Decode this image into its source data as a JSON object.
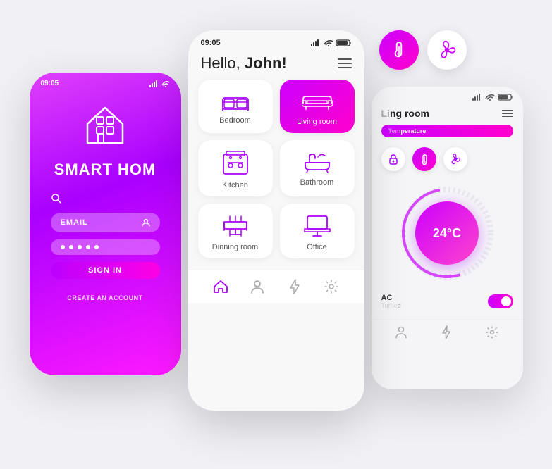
{
  "app": {
    "title": "Smart Home"
  },
  "left_phone": {
    "status_time": "09:05",
    "title": "SMART HOM",
    "email_placeholder": "EMAIL",
    "password_dots": 5,
    "sign_in_label": "SIGN IN",
    "create_account_label": "CREATE AN ACCOUNT"
  },
  "center_phone": {
    "status_time": "09:05",
    "greeting": "Hello, ",
    "greeting_name": "John!",
    "rooms": [
      {
        "id": "bedroom",
        "label": "Bedroom",
        "active": false,
        "icon": "bed"
      },
      {
        "id": "living-room",
        "label": "Living room",
        "active": true,
        "icon": "sofa"
      },
      {
        "id": "kitchen",
        "label": "Kitchen",
        "active": false,
        "icon": "stove"
      },
      {
        "id": "bathroom",
        "label": "Bathroom",
        "active": false,
        "icon": "bathtub"
      },
      {
        "id": "dining-room",
        "label": "Dinning room",
        "active": false,
        "icon": "table"
      },
      {
        "id": "office",
        "label": "Office",
        "active": false,
        "icon": "desk"
      }
    ],
    "nav_items": [
      "home",
      "user",
      "bolt",
      "settings"
    ]
  },
  "right_phone": {
    "room_title": "ng room",
    "temp_badge": "perature",
    "temperature": "24°C",
    "ac_label": "AC",
    "ac_sub": "d",
    "controls": [
      "lock",
      "thermometer",
      "fan"
    ]
  },
  "float_icons": {
    "thermometer": {
      "label": "thermometer-float"
    },
    "fan": {
      "label": "fan-float"
    }
  }
}
